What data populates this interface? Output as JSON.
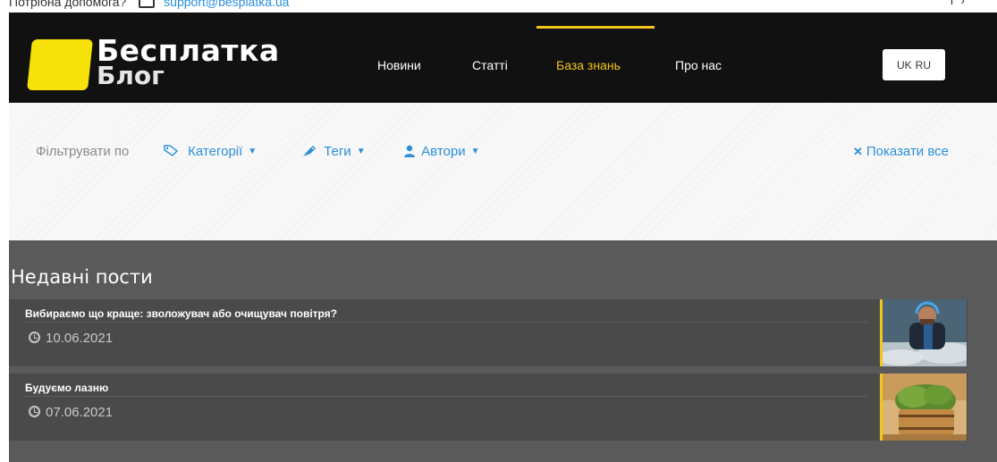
{
  "topbar": {
    "help_text": "Потрібна допомога?",
    "email": "support@besplatka.ua",
    "icon": "mail-icon"
  },
  "header": {
    "logo_line1": "Бесплатка",
    "logo_line2": "Блог",
    "nav": [
      {
        "label": "Новини"
      },
      {
        "label": "Статті"
      },
      {
        "label": "База знань",
        "active": true
      },
      {
        "label": "Про нас"
      }
    ],
    "lang": [
      "UK",
      "RU"
    ],
    "accent_color": "#f4c51c"
  },
  "filter": {
    "label": "Фільтрувати по",
    "categories": "Категорії",
    "tags": "Теги",
    "authors": "Автори",
    "show_all": "Показати все",
    "link_color": "#2a8fd8"
  },
  "recent": {
    "heading": "Недавні пости",
    "posts": [
      {
        "title": "Вибираємо що краще: зволожувач або очищувач повітря?",
        "date": "10.06.2021"
      },
      {
        "title": "Будуємо лазню",
        "date": "07.06.2021"
      }
    ]
  }
}
